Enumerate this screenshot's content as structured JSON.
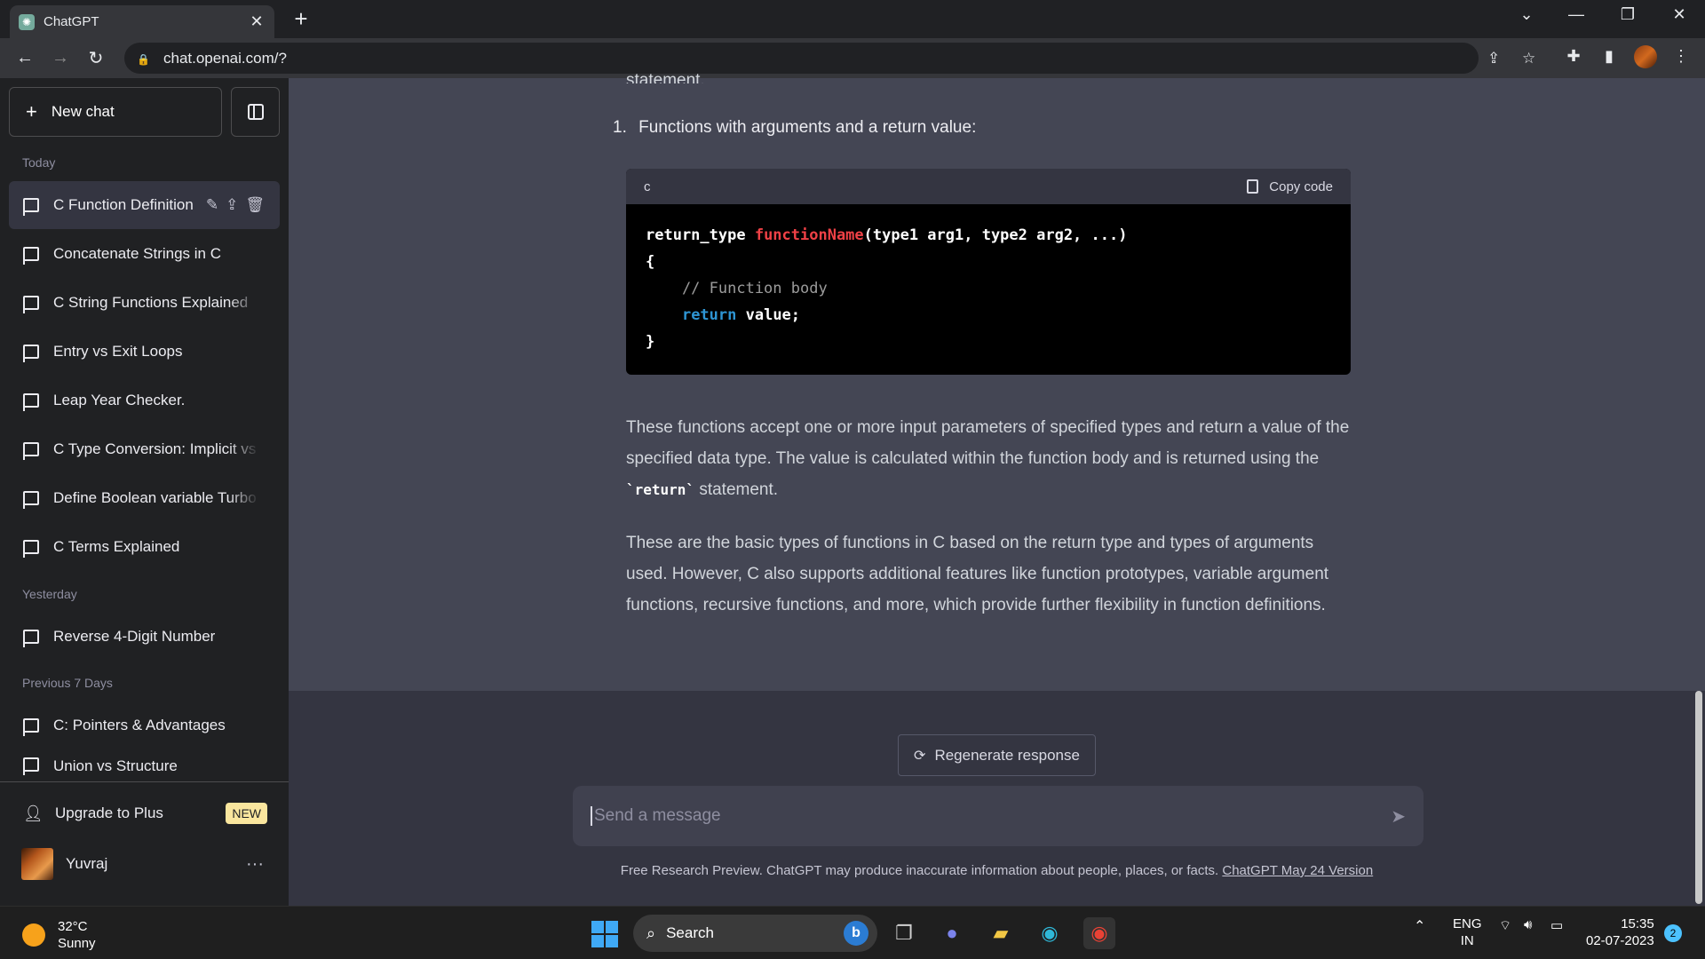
{
  "browser": {
    "tab_title": "ChatGPT",
    "url": "chat.openai.com/?"
  },
  "sidebar": {
    "new_chat": "New chat",
    "sections": {
      "today": "Today",
      "yesterday": "Yesterday",
      "previous": "Previous 7 Days"
    },
    "items": [
      {
        "label": "C Function Definition"
      },
      {
        "label": "Concatenate Strings in C"
      },
      {
        "label": "C String Functions Explained"
      },
      {
        "label": "Entry vs Exit Loops"
      },
      {
        "label": "Leap Year Checker."
      },
      {
        "label": "C Type Conversion: Implicit vs"
      },
      {
        "label": "Define Boolean variable Turbo"
      },
      {
        "label": "C Terms Explained"
      },
      {
        "label": "Reverse 4-Digit Number"
      },
      {
        "label": "C: Pointers & Advantages"
      },
      {
        "label": "Union vs Structure"
      }
    ],
    "upgrade": "Upgrade to Plus",
    "badge": "NEW",
    "user": "Yuvraj",
    "more": "···"
  },
  "conversation": {
    "cut_text": "statement.",
    "list_number": "1.",
    "list_text": "Functions with arguments and a return value:",
    "code_lang": "c",
    "copy_code": "Copy code",
    "code": {
      "l1_type": "return_type ",
      "l1_fn": "functionName",
      "l1_args": "(type1 arg1, type2 arg2, ...)",
      "l2": "{",
      "l3": "    // Function body",
      "l4_indent": "    ",
      "l4_kw": "return",
      "l4_rest": " value;",
      "l5": "}"
    },
    "para1_a": "These functions accept one or more input parameters of specified types and return a value of the specified data type. The value is calculated within the function body and is returned using the ",
    "para1_code": "`return`",
    "para1_b": " statement.",
    "para2": "These are the basic types of functions in C based on the return type and types of arguments used. However, C also supports additional features like function prototypes, variable argument functions, recursive functions, and more, which provide further flexibility in function definitions."
  },
  "composer": {
    "regenerate": "Regenerate response",
    "placeholder": "Send a message",
    "footer": "Free Research Preview. ChatGPT may produce inaccurate information about people, places, or facts. ",
    "footer_link": "ChatGPT May 24 Version"
  },
  "taskbar": {
    "temp": "32°C",
    "weather": "Sunny",
    "search": "Search",
    "lang1": "ENG",
    "lang2": "IN",
    "time": "15:35",
    "date": "02-07-2023",
    "notifications": "2"
  },
  "colors": {
    "sidebar_bg": "#202123",
    "message_bg": "#444654",
    "accent_red": "#ef4146",
    "accent_blue": "#2e95d3",
    "badge": "#fae69e"
  }
}
